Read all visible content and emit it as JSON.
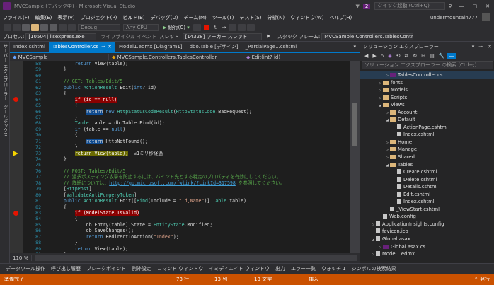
{
  "window": {
    "title": "MVCSample (デバッグ中) - Microsoft Visual Studio",
    "quick_launch": "クイック起動 (Ctrl+Q)",
    "user": "undermountain777",
    "notification_count": "2"
  },
  "menu": [
    "ファイル(F)",
    "編集(E)",
    "表示(V)",
    "プロジェクト(P)",
    "ビルド(B)",
    "デバッグ(D)",
    "チーム(M)",
    "ツール(T)",
    "テスト(S)",
    "分析(N)",
    "ウィンドウ(W)",
    "ヘルプ(H)"
  ],
  "toolbar": {
    "config": "Debug",
    "platform": "Any CPU",
    "continue_label": "続行(C)"
  },
  "debugbar": {
    "process_label": "プロセス:",
    "process": "[10504] iisexpress.exe",
    "lifecycle": "ライフサイクル イベント",
    "thread_label": "スレッド:",
    "thread": "[14328] ワーカー スレッド",
    "stack_label": "スタック フレーム:",
    "stack": "MVCSample.Controllers.TablesController.Er"
  },
  "left_tabs": [
    "サーバー エクスプローラー",
    "ツールボックス"
  ],
  "doc_tabs": [
    "Index.cshtml",
    "TablesController.cs",
    "Model1.edmx [Diagram1]",
    "dbo.Table [デザイン]",
    "_PartialPage1.cshtml"
  ],
  "nav": {
    "project": "MVCSample",
    "class": "MVCSample.Controllers.TablesController",
    "member": "Edit(int? id)"
  },
  "line_numbers": [
    "58",
    "59",
    "60",
    "61",
    "62",
    "63",
    "64",
    "65",
    "66",
    "67",
    "68",
    "69",
    "70",
    "71",
    "72",
    "73",
    "74",
    "75",
    "76",
    "77",
    "78",
    "79",
    "80",
    "81",
    "82",
    "83",
    "84",
    "85",
    "86",
    "87",
    "88",
    "89",
    "90",
    "91",
    "92"
  ],
  "code_lines": [
    [
      [
        "",
        "        "
      ],
      [
        "kw",
        "return"
      ],
      [
        "",
        " View(table);"
      ]
    ],
    [
      [
        "",
        "    }"
      ]
    ],
    [
      [
        "",
        ""
      ]
    ],
    [
      [
        "cm",
        "    // GET: Tables/Edit/5"
      ]
    ],
    [
      [
        "",
        "    "
      ],
      [
        "kw",
        "public"
      ],
      [
        "",
        " "
      ],
      [
        "ty",
        "ActionResult"
      ],
      [
        "",
        " Edit("
      ],
      [
        "kw",
        "int"
      ],
      [
        "",
        "? id)"
      ]
    ],
    [
      [
        "",
        "    {"
      ]
    ],
    [
      [
        "",
        "        "
      ],
      [
        "bp",
        "if (id == null)"
      ]
    ],
    [
      [
        "",
        "        {"
      ]
    ],
    [
      [
        "",
        "            "
      ],
      [
        "hl",
        "return"
      ],
      [
        "",
        " "
      ],
      [
        "kw",
        "new"
      ],
      [
        "",
        " "
      ],
      [
        "ty",
        "HttpStatusCodeResult"
      ],
      [
        "",
        "("
      ],
      [
        "ty",
        "HttpStatusCode"
      ],
      [
        "",
        ".BadRequest);"
      ]
    ],
    [
      [
        "",
        "        }"
      ]
    ],
    [
      [
        "",
        "        "
      ],
      [
        "ty",
        "Table"
      ],
      [
        "",
        " table = db.Table.Find(id);"
      ]
    ],
    [
      [
        "",
        "        "
      ],
      [
        "kw",
        "if"
      ],
      [
        "",
        " (table == "
      ],
      [
        "kw",
        "null"
      ],
      [
        "",
        ")"
      ]
    ],
    [
      [
        "",
        "        {"
      ]
    ],
    [
      [
        "",
        "            "
      ],
      [
        "hl",
        "return"
      ],
      [
        "",
        " HttpNotFound();"
      ]
    ],
    [
      [
        "",
        "        }"
      ]
    ],
    [
      [
        "",
        "        "
      ],
      [
        "cur",
        "return View(table);"
      ],
      [
        "",
        "  ≤1ミリ秒経過"
      ]
    ],
    [
      [
        "",
        "    }"
      ]
    ],
    [
      [
        "",
        ""
      ]
    ],
    [
      [
        "cm",
        "    // POST: Tables/Edit/5"
      ]
    ],
    [
      [
        "cm",
        "    // 過多ポスティング攻撃を防止するには、バインド先とする特定のプロパティを有効にしてください。"
      ]
    ],
    [
      [
        "cm",
        "    // 詳細については、"
      ],
      [
        "lk",
        "http://go.microsoft.com/fwlink/?LinkId=317598"
      ],
      [
        "cm",
        " を参照してください。"
      ]
    ],
    [
      [
        "",
        "    ["
      ],
      [
        "at",
        "HttpPost"
      ],
      [
        "",
        "]"
      ]
    ],
    [
      [
        "",
        "    ["
      ],
      [
        "at",
        "ValidateAntiForgeryToken"
      ],
      [
        "",
        "]"
      ]
    ],
    [
      [
        "",
        "    "
      ],
      [
        "kw",
        "public"
      ],
      [
        "",
        " "
      ],
      [
        "ty",
        "ActionResult"
      ],
      [
        "",
        " Edit(["
      ],
      [
        "at",
        "Bind"
      ],
      [
        "",
        "(Include = "
      ],
      [
        "st",
        "\"Id,Name\""
      ],
      [
        "",
        ")] "
      ],
      [
        "ty",
        "Table"
      ],
      [
        "",
        " table)"
      ]
    ],
    [
      [
        "",
        "    {"
      ]
    ],
    [
      [
        "",
        "        "
      ],
      [
        "bp",
        "if (ModelState.IsValid)"
      ]
    ],
    [
      [
        "",
        "        {"
      ]
    ],
    [
      [
        "",
        "            db.Entry(table).State = "
      ],
      [
        "ty",
        "EntityState"
      ],
      [
        "",
        ".Modified;"
      ]
    ],
    [
      [
        "",
        "            db.SaveChanges();"
      ]
    ],
    [
      [
        "",
        "            "
      ],
      [
        "kw",
        "return"
      ],
      [
        "",
        " RedirectToAction("
      ],
      [
        "st",
        "\"Index\""
      ],
      [
        "",
        ");"
      ]
    ],
    [
      [
        "",
        "        }"
      ]
    ],
    [
      [
        "",
        "        "
      ],
      [
        "kw",
        "return"
      ],
      [
        "",
        " View(table);"
      ]
    ],
    [
      [
        "",
        "    }"
      ]
    ],
    [
      [
        "",
        ""
      ]
    ],
    [
      [
        "",
        ""
      ]
    ]
  ],
  "breakpoint_rows": [
    6,
    25
  ],
  "current_row": 15,
  "zoom": "110 %",
  "output_tabs": [
    "データツール操作",
    "呼び出し履歴",
    "ブレークポイント",
    "例外設定",
    "コマンド ウィンドウ",
    "イミディエイト ウィンドウ",
    "出力",
    "エラー一覧",
    "ウォッチ 1",
    "シンボルの検索結果"
  ],
  "status": {
    "state": "準備完了",
    "line": "73 行",
    "col": "13 列",
    "ch": "13 文字",
    "mode": "挿入",
    "publish": "↑ 発行"
  },
  "solution_explorer": {
    "title": "ソリューション エクスプローラー",
    "search": "ソリューション エクスプローラー の検索 (Ctrl+;)",
    "items": [
      {
        "label": "TablesController.cs",
        "depth": 3,
        "kind": "cs",
        "expand": "▷",
        "selected": true
      },
      {
        "label": "fonts",
        "depth": 2,
        "kind": "folder",
        "expand": "▷"
      },
      {
        "label": "Models",
        "depth": 2,
        "kind": "folder",
        "expand": "▷"
      },
      {
        "label": "Scripts",
        "depth": 2,
        "kind": "folder",
        "expand": "▷"
      },
      {
        "label": "Views",
        "depth": 2,
        "kind": "folder",
        "expand": "◢"
      },
      {
        "label": "Account",
        "depth": 3,
        "kind": "folder",
        "expand": "▷"
      },
      {
        "label": "Default",
        "depth": 3,
        "kind": "folder",
        "expand": "◢"
      },
      {
        "label": "ActionPage.cshtml",
        "depth": 4,
        "kind": "file",
        "expand": ""
      },
      {
        "label": "Index.cshtml",
        "depth": 4,
        "kind": "file",
        "expand": ""
      },
      {
        "label": "Home",
        "depth": 3,
        "kind": "folder",
        "expand": "▷"
      },
      {
        "label": "Manage",
        "depth": 3,
        "kind": "folder",
        "expand": "▷"
      },
      {
        "label": "Shared",
        "depth": 3,
        "kind": "folder",
        "expand": "▷"
      },
      {
        "label": "Tables",
        "depth": 3,
        "kind": "folder",
        "expand": "◢"
      },
      {
        "label": "Create.cshtml",
        "depth": 4,
        "kind": "file",
        "expand": ""
      },
      {
        "label": "Delete.cshtml",
        "depth": 4,
        "kind": "file",
        "expand": ""
      },
      {
        "label": "Details.cshtml",
        "depth": 4,
        "kind": "file",
        "expand": ""
      },
      {
        "label": "Edit.cshtml",
        "depth": 4,
        "kind": "file",
        "expand": ""
      },
      {
        "label": "Index.cshtml",
        "depth": 4,
        "kind": "file",
        "expand": ""
      },
      {
        "label": "_ViewStart.cshtml",
        "depth": 3,
        "kind": "file",
        "expand": ""
      },
      {
        "label": "Web.config",
        "depth": 2,
        "kind": "file",
        "expand": ""
      },
      {
        "label": "ApplicationInsights.config",
        "depth": 1,
        "kind": "file",
        "expand": "▷"
      },
      {
        "label": "favicon.ico",
        "depth": 1,
        "kind": "file",
        "expand": ""
      },
      {
        "label": "Global.asax",
        "depth": 1,
        "kind": "file",
        "expand": "◢"
      },
      {
        "label": "Global.asax.cs",
        "depth": 2,
        "kind": "cs",
        "expand": "▷"
      },
      {
        "label": "Model1.edmx",
        "depth": 1,
        "kind": "file",
        "expand": "▷"
      }
    ]
  },
  "colors": {
    "accent": "#007acc",
    "status": "#ca5100",
    "editor_bg": "#1e1e1e",
    "breakpoint": "#e51400"
  }
}
